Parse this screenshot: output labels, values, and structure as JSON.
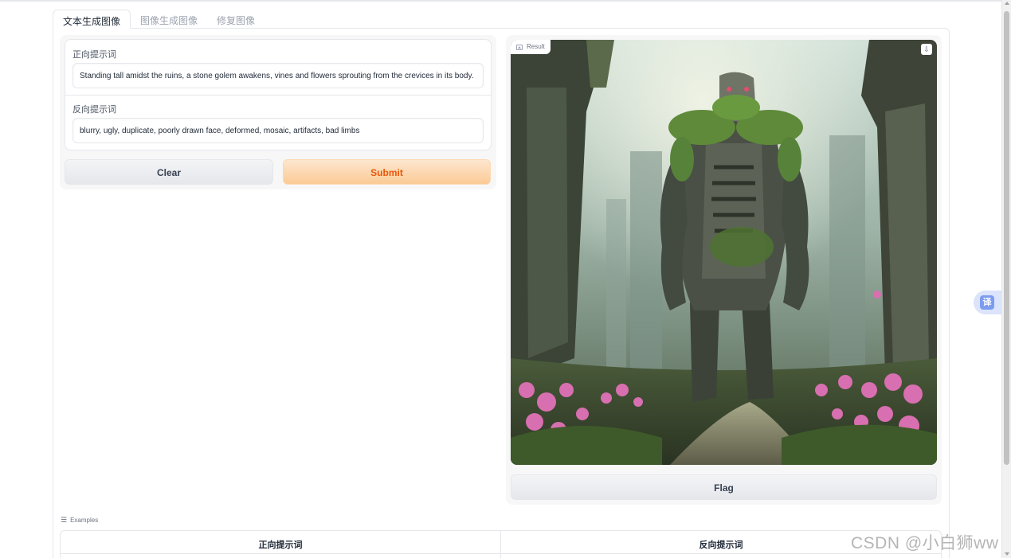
{
  "tabs": [
    {
      "label": "文本生成图像",
      "active": true
    },
    {
      "label": "图像生成图像",
      "active": false
    },
    {
      "label": "修复图像",
      "active": false
    }
  ],
  "positive_prompt": {
    "label": "正向提示词",
    "value": "Standing tall amidst the ruins, a stone golem awakens, vines and flowers sprouting from the crevices in its body."
  },
  "negative_prompt": {
    "label": "反向提示词",
    "value": "blurry, ugly, duplicate, poorly drawn face, deformed, mosaic, artifacts, bad limbs"
  },
  "buttons": {
    "clear": "Clear",
    "submit": "Submit",
    "flag": "Flag"
  },
  "result": {
    "label": "Result"
  },
  "examples": {
    "label": "Examples",
    "columns": [
      "正向提示词",
      "反向提示词"
    ]
  },
  "translate_widget": {
    "label": "译"
  },
  "watermark": "CSDN @小白狮ww",
  "colors": {
    "submit_text": "#ea580c",
    "submit_bg": "#fbcb95",
    "translate_accent": "#7c9cf0"
  }
}
